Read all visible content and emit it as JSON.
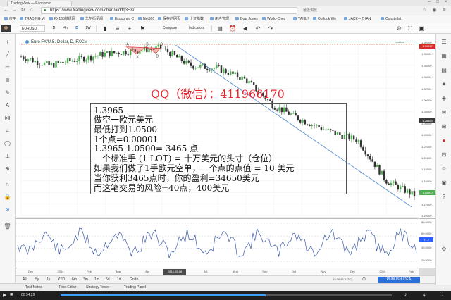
{
  "browser": {
    "tab_title": "TradingView — Economic",
    "url": "https://www.tradingview.com/chart/aiddq3H8/",
    "window_controls": [
      "–",
      "□",
      "×"
    ],
    "address_right": "最近浏览"
  },
  "bookmarks": [
    {
      "label": "应用"
    },
    {
      "label": "TRADING VI"
    },
    {
      "label": "FX168财经网"
    },
    {
      "label": "华尔街见闻"
    },
    {
      "label": "Economic C"
    },
    {
      "label": "Net360"
    },
    {
      "label": "保存的网页"
    },
    {
      "label": "上证指数"
    },
    {
      "label": "用户管理"
    },
    {
      "label": "Dow Jones"
    },
    {
      "label": "World-Chec"
    },
    {
      "label": "YAHU!"
    },
    {
      "label": "Outlook We"
    },
    {
      "label": "JACK－ZHAN"
    },
    {
      "label": "Constellat"
    }
  ],
  "toolbar": {
    "symbol": "EURUSD",
    "interval_1h": "1h",
    "interval_4h": "4h",
    "interval_d": "D",
    "interval_w": "1W",
    "compare_label": "Compare",
    "indicators_label": "Indicators",
    "camera_label": "▣"
  },
  "chart": {
    "legend": "Euro FX/U.S. Dollar, D, FXCM",
    "realtime": "realtime",
    "accent_red": "#e8212a",
    "candle_green": "#4caf50",
    "trend_blue": "#5b8fd0",
    "resistance_red": "#d62b2b",
    "price_axis_labels": [
      "1.40000",
      "1.38000",
      "1.36000",
      "1.34000",
      "1.32000",
      "1.30000",
      "1.28000",
      "1.26000",
      "1.24000",
      "1.22000",
      "1.20000",
      "1.18000",
      "1.16000",
      "1.14000",
      "1.12000",
      "1.10000"
    ],
    "price_badge_top": "1.39657",
    "price_badge_mid": "1.26863",
    "price_badge_last": "1.13400",
    "pattern_labels": [
      "A",
      "X",
      "B",
      "D",
      "C"
    ],
    "time_labels": [
      "Dec",
      "2014",
      "Feb",
      "Mar",
      "Apr",
      "Jun",
      "Jul",
      "Aug",
      "Sep",
      "Oct",
      "Nov",
      "Dec",
      "2015",
      "Feb"
    ],
    "time_badge": "2014-05-08",
    "osc_labels": [
      "80.0000",
      "60.0000",
      "40.0000",
      "20.0000"
    ],
    "osc_badge": "57.2"
  },
  "chart_data": {
    "type": "line",
    "x": [
      "2013-12",
      "2014-01",
      "2014-02",
      "2014-03",
      "2014-04",
      "2014-05",
      "2014-06",
      "2014-07",
      "2014-08",
      "2014-09",
      "2014-10",
      "2014-11",
      "2014-12",
      "2015-01",
      "2015-02"
    ],
    "series": [
      {
        "values": [
          1.375,
          1.36,
          1.37,
          1.38,
          1.385,
          1.39,
          1.36,
          1.355,
          1.335,
          1.29,
          1.265,
          1.245,
          1.23,
          1.16,
          1.135
        ]
      }
    ],
    "ylim": [
      1.1,
      1.4
    ]
  },
  "qq_overlay": "QQ（微信）：411966170",
  "note": {
    "lines": [
      "1.3965",
      "做空一欧元美元",
      "最低打到1.0500",
      "1个点=0.00001",
      "1.3965-1.0500= 3465 点",
      "一个标准手 (1 LOT)  = 十万美元的头寸（仓位）",
      "如果我们做了1手欧元空单，一个点的点值 = 10 美元",
      "当你获利3465点时，你的盈利=34650美元",
      "而这笔交易的风险=40点，400美元"
    ]
  },
  "sponsor": {
    "small": "Sponsored by",
    "logo": "FXCM"
  },
  "rangebar": {
    "items": [
      "All",
      "5y",
      "1y",
      "YTD",
      "6m",
      "3m",
      "1m",
      "5d",
      "1d",
      "Go to..."
    ],
    "clock": "20:38:45 (UTC)",
    "publish_label": "PUBLISH IDEA"
  },
  "bottom_tabs": [
    "Text Notes",
    "Pine Editor",
    "Strategy Tester",
    "Trading Panel"
  ],
  "player": {
    "time": "00:54:29",
    "progress": 0.62,
    "right_text": "中"
  }
}
